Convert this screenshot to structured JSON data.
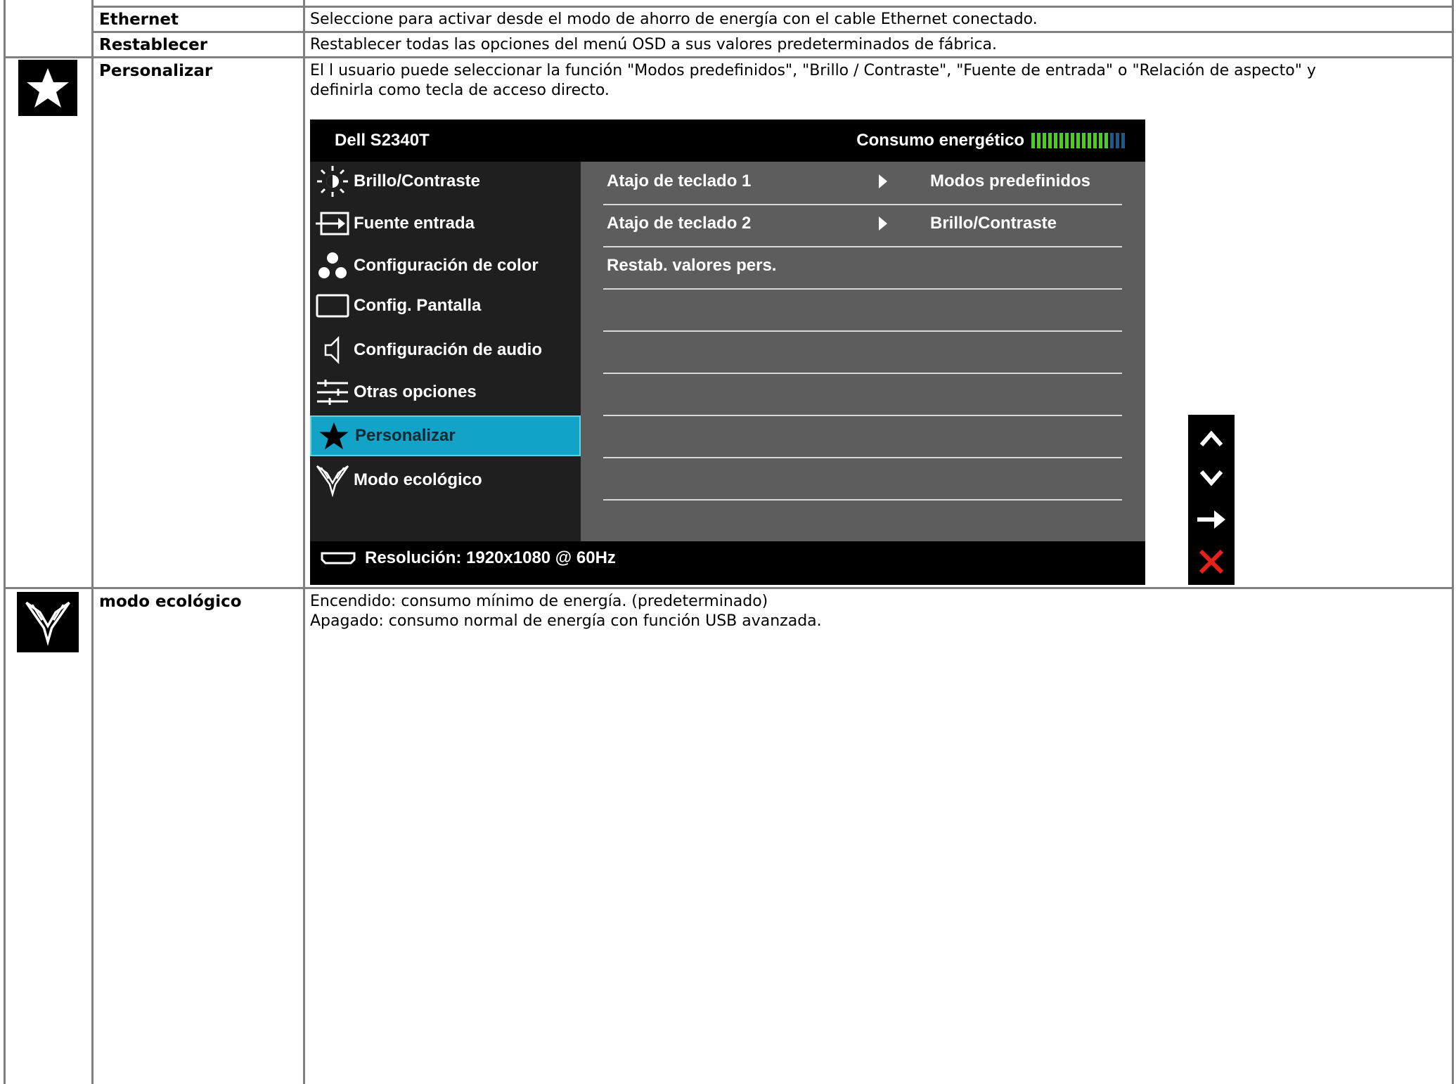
{
  "rows": {
    "ethernet": {
      "label": "Ethernet",
      "description": "Seleccione para activar desde el modo de ahorro de energía con el cable Ethernet conectado."
    },
    "restablecer": {
      "label": "Restablecer",
      "description": "Restablecer todas las opciones del menú OSD a sus valores predeterminados de fábrica."
    },
    "personalizar": {
      "label": "Personalizar",
      "icon": "star-icon",
      "description": "El l usuario puede seleccionar la función \"Modos predefinidos\", \"Brillo / Contraste\", \"Fuente de entrada\" o \"Relación de aspecto\" y\ndefinirla como tecla de acceso directo."
    },
    "eco": {
      "label": "modo ecológico",
      "icon": "eco-mode-icon",
      "description": "Encendido: consumo mínimo de energía. (predeterminado)\nApagado: consumo normal de energía con función USB avanzada."
    }
  },
  "osd": {
    "title": "Dell S2340T",
    "power_label": "Consumo energético",
    "power_level_fraction": 0.8,
    "menu": [
      {
        "label": "Brillo/Contraste",
        "icon": "brightness-icon"
      },
      {
        "label": "Fuente entrada",
        "icon": "input-source-icon"
      },
      {
        "label": "Configuración de color",
        "icon": "color-settings-icon"
      },
      {
        "label": "Config. Pantalla",
        "icon": "display-settings-icon"
      },
      {
        "label": "Configuración de audio",
        "icon": "speaker-icon"
      },
      {
        "label": "Otras opciones",
        "icon": "other-settings-icon"
      },
      {
        "label": "Personalizar",
        "icon": "star-icon",
        "selected": true
      },
      {
        "label": "Modo ecológico",
        "icon": "eco-mode-icon"
      }
    ],
    "submenu": [
      {
        "label": "Atajo de teclado 1",
        "value": "Modos predefinidos"
      },
      {
        "label": "Atajo de teclado 2",
        "value": "Brillo/Contraste"
      },
      {
        "label": "Restab. valores pers.",
        "value": ""
      }
    ],
    "footer": "Resolución: 1920x1080 @ 60Hz"
  },
  "nav_buttons": [
    "up-icon",
    "down-icon",
    "right-arrow-icon",
    "close-icon"
  ],
  "colors": {
    "osd_selected": "#13a3c6",
    "power_bar_on": "#46d21e",
    "power_bar_off": "#1f5a86",
    "close_red": "#e8201c"
  }
}
